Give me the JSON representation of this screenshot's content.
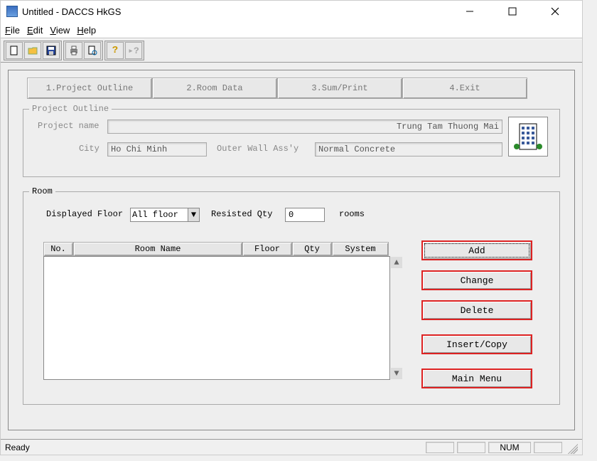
{
  "window": {
    "title": "Untitled - DACCS HkGS"
  },
  "menubar": {
    "file": "File",
    "edit": "Edit",
    "view": "View",
    "help": "Help"
  },
  "toolbar_icons": {
    "new": "new-icon",
    "open": "open-icon",
    "save": "save-icon",
    "print": "print-icon",
    "preview": "preview-icon",
    "help": "help-icon",
    "context_help": "context-help-icon"
  },
  "tabs": {
    "t1": "1.Project Outline",
    "t2": "2.Room Data",
    "t3": "3.Sum/Print",
    "t4": "4.Exit"
  },
  "project_outline": {
    "legend": "Project Outline",
    "project_name_label": "Project name",
    "project_name_value": "Trung Tam Thuong Mai",
    "city_label": "City",
    "city_value": "Ho Chi Minh",
    "wall_label": "Outer Wall Ass'y",
    "wall_value": "Normal Concrete"
  },
  "room": {
    "legend": "Room",
    "displayed_floor_label": "Displayed Floor",
    "displayed_floor_value": "All floor",
    "resisted_qty_label": "Resisted Qty",
    "resisted_qty_value": "0",
    "rooms_suffix": "rooms",
    "columns": {
      "no": "No.",
      "name": "Room Name",
      "floor": "Floor",
      "qty": "Qty",
      "system": "System"
    },
    "buttons": {
      "add": "Add",
      "change": "Change",
      "delete": "Delete",
      "insert_copy": "Insert/Copy",
      "main_menu": "Main Menu"
    }
  },
  "status": {
    "ready": "Ready",
    "num": "NUM"
  }
}
